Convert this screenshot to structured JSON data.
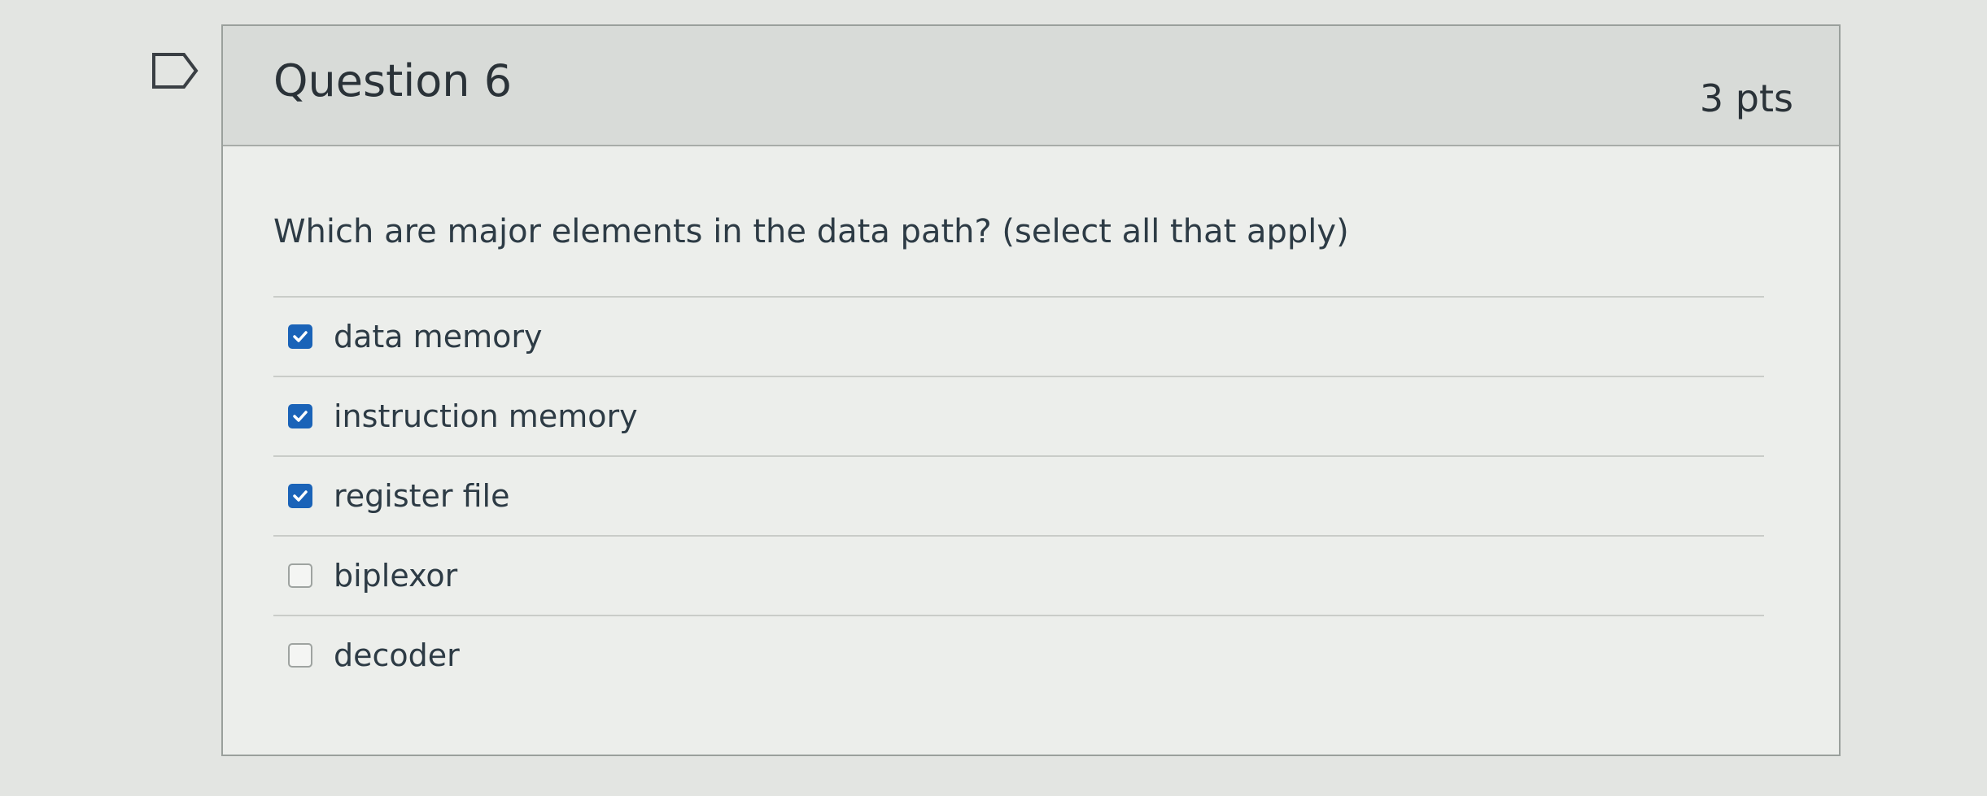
{
  "question": {
    "title": "Question 6",
    "points": "3 pts",
    "text": "Which are major elements in the data path? (select all that apply)",
    "flag_icon": "flag-icon"
  },
  "answers": [
    {
      "label": "data memory",
      "checked": true
    },
    {
      "label": "instruction memory",
      "checked": true
    },
    {
      "label": "register file",
      "checked": true
    },
    {
      "label": "biplexor",
      "checked": false
    },
    {
      "label": "decoder",
      "checked": false
    }
  ],
  "colors": {
    "checkbox_checked": "#1a63b8",
    "text": "#2d3b45"
  }
}
